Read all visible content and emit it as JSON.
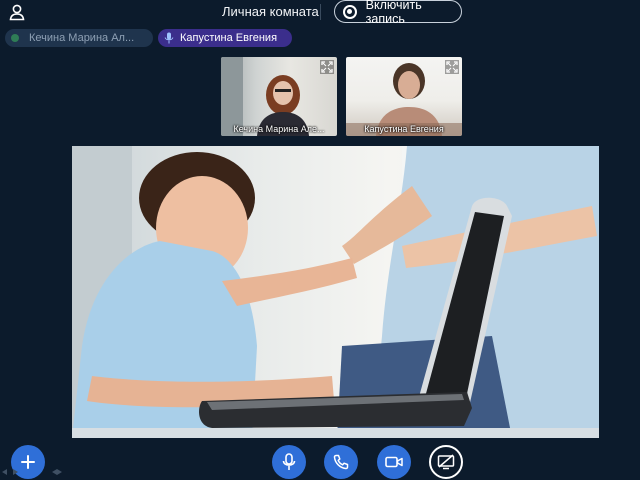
{
  "header": {
    "room_title": "Личная комната",
    "record_label": "Включить запись",
    "icons": {
      "user": "user-icon",
      "record": "record-icon"
    }
  },
  "participants": [
    {
      "name": "Кечина Марина Ал...",
      "status_icon": "status-dot-icon",
      "active": false
    },
    {
      "name": "Капустина Евгения",
      "status_icon": "microphone-icon",
      "active": true
    }
  ],
  "thumbnails": [
    {
      "label": "Кечина Марина Але...",
      "icon": "expand-icon"
    },
    {
      "label": "Капустина Евгения",
      "icon": "expand-icon"
    }
  ],
  "toolbar": {
    "buttons": [
      {
        "name": "add",
        "icon": "plus-icon"
      },
      {
        "name": "microphone",
        "icon": "microphone-icon"
      },
      {
        "name": "hangup",
        "icon": "phone-icon"
      },
      {
        "name": "camera",
        "icon": "video-camera-icon"
      },
      {
        "name": "screen-share",
        "icon": "screen-share-off-icon"
      }
    ]
  },
  "colors": {
    "background": "#0c1b2c",
    "accent": "#2f6fd8",
    "active_chip": "#3b2e8c",
    "inactive_chip": "#1f344d"
  }
}
